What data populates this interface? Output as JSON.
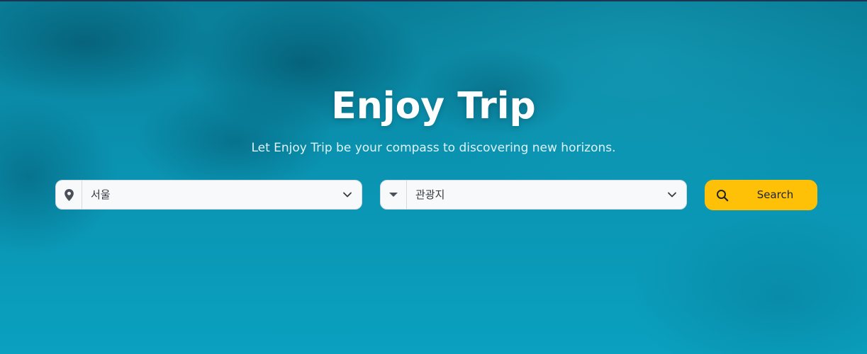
{
  "hero": {
    "title": "Enjoy Trip",
    "subtitle": "Let Enjoy Trip be your compass to discovering new horizons."
  },
  "search": {
    "region_select": {
      "icon": "map-marker-icon",
      "value": "서울"
    },
    "category_select": {
      "icon": "caret-down-icon",
      "value": "관광지"
    },
    "button": {
      "icon": "search-icon",
      "label": "Search"
    }
  },
  "colors": {
    "accent_button": "#ffc107",
    "title_text": "#ffffff",
    "ocean_background": "#0a93b1"
  }
}
